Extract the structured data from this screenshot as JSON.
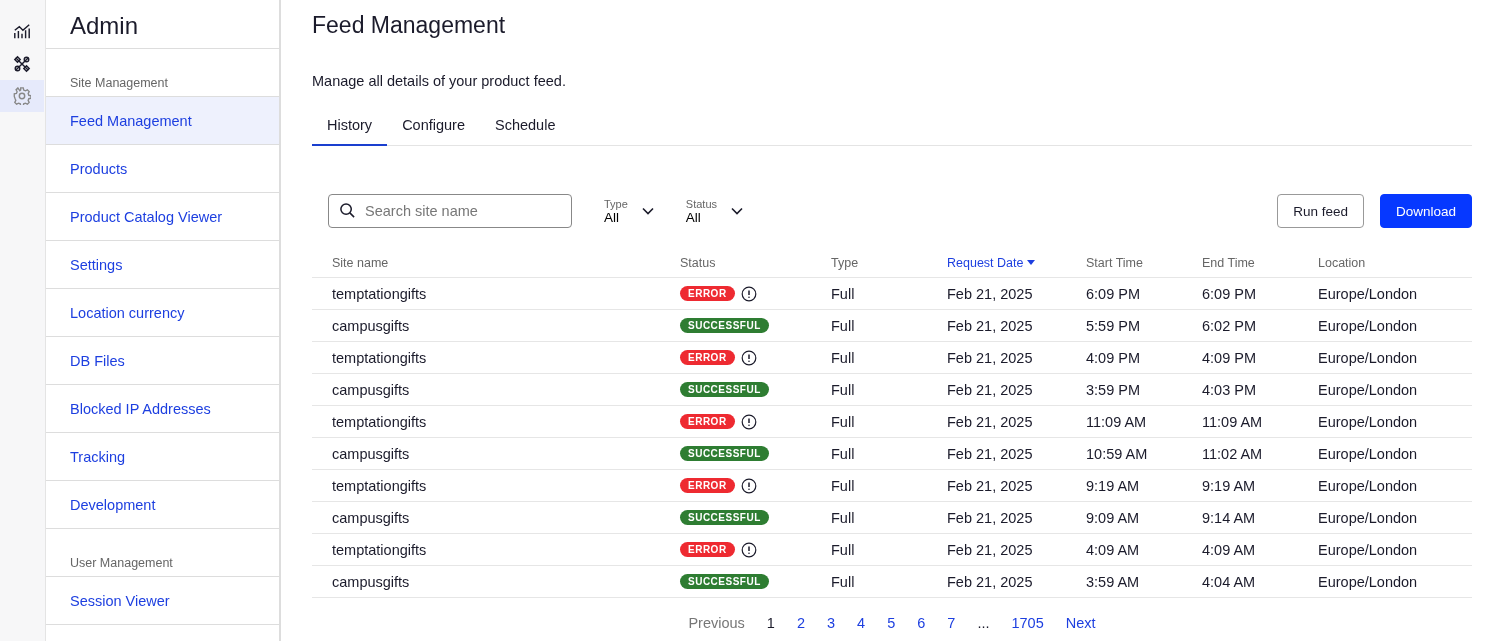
{
  "rail": [
    {
      "selected": false
    },
    {
      "selected": false
    },
    {
      "selected": true
    }
  ],
  "sidebar": {
    "title": "Admin",
    "sections": [
      {
        "label": "Site Management",
        "items": [
          {
            "label": "Feed Management",
            "selected": true
          },
          {
            "label": "Products",
            "selected": false
          },
          {
            "label": "Product Catalog Viewer",
            "selected": false
          },
          {
            "label": "Settings",
            "selected": false
          },
          {
            "label": "Location currency",
            "selected": false
          },
          {
            "label": "DB Files",
            "selected": false
          },
          {
            "label": "Blocked IP Addresses",
            "selected": false
          },
          {
            "label": "Tracking",
            "selected": false
          },
          {
            "label": "Development",
            "selected": false
          }
        ]
      },
      {
        "label": "User Management",
        "items": [
          {
            "label": "Session Viewer",
            "selected": false
          }
        ]
      }
    ]
  },
  "page": {
    "title": "Feed Management",
    "subtitle": "Manage all details of your product feed."
  },
  "tabs": [
    {
      "label": "History",
      "selected": true
    },
    {
      "label": "Configure",
      "selected": false
    },
    {
      "label": "Schedule",
      "selected": false
    }
  ],
  "search": {
    "placeholder": "Search site name"
  },
  "filters": [
    {
      "label": "Type",
      "value": "All"
    },
    {
      "label": "Status",
      "value": "All"
    }
  ],
  "buttons": [
    {
      "label": "Run feed",
      "kind": "secondary"
    },
    {
      "label": "Download",
      "kind": "primary"
    }
  ],
  "table": {
    "columns": [
      {
        "label": "Site name",
        "sorted": false
      },
      {
        "label": "Status",
        "sorted": false
      },
      {
        "label": "Type",
        "sorted": false
      },
      {
        "label": "Request Date",
        "sorted": true
      },
      {
        "label": "Start Time",
        "sorted": false
      },
      {
        "label": "End Time",
        "sorted": false
      },
      {
        "label": "Location",
        "sorted": false
      }
    ],
    "rows": [
      {
        "site": "temptationgifts",
        "status": "ERROR",
        "kind": "error",
        "type": "Full",
        "date": "Feb 21, 2025",
        "start": "6:09 PM",
        "end": "6:09 PM",
        "location": "Europe/London"
      },
      {
        "site": "campusgifts",
        "status": "SUCCESSFUL",
        "kind": "success",
        "type": "Full",
        "date": "Feb 21, 2025",
        "start": "5:59 PM",
        "end": "6:02 PM",
        "location": "Europe/London"
      },
      {
        "site": "temptationgifts",
        "status": "ERROR",
        "kind": "error",
        "type": "Full",
        "date": "Feb 21, 2025",
        "start": "4:09 PM",
        "end": "4:09 PM",
        "location": "Europe/London"
      },
      {
        "site": "campusgifts",
        "status": "SUCCESSFUL",
        "kind": "success",
        "type": "Full",
        "date": "Feb 21, 2025",
        "start": "3:59 PM",
        "end": "4:03 PM",
        "location": "Europe/London"
      },
      {
        "site": "temptationgifts",
        "status": "ERROR",
        "kind": "error",
        "type": "Full",
        "date": "Feb 21, 2025",
        "start": "11:09 AM",
        "end": "11:09 AM",
        "location": "Europe/London"
      },
      {
        "site": "campusgifts",
        "status": "SUCCESSFUL",
        "kind": "success",
        "type": "Full",
        "date": "Feb 21, 2025",
        "start": "10:59 AM",
        "end": "11:02 AM",
        "location": "Europe/London"
      },
      {
        "site": "temptationgifts",
        "status": "ERROR",
        "kind": "error",
        "type": "Full",
        "date": "Feb 21, 2025",
        "start": "9:19 AM",
        "end": "9:19 AM",
        "location": "Europe/London"
      },
      {
        "site": "campusgifts",
        "status": "SUCCESSFUL",
        "kind": "success",
        "type": "Full",
        "date": "Feb 21, 2025",
        "start": "9:09 AM",
        "end": "9:14 AM",
        "location": "Europe/London"
      },
      {
        "site": "temptationgifts",
        "status": "ERROR",
        "kind": "error",
        "type": "Full",
        "date": "Feb 21, 2025",
        "start": "4:09 AM",
        "end": "4:09 AM",
        "location": "Europe/London"
      },
      {
        "site": "campusgifts",
        "status": "SUCCESSFUL",
        "kind": "success",
        "type": "Full",
        "date": "Feb 21, 2025",
        "start": "3:59 AM",
        "end": "4:04 AM",
        "location": "Europe/London"
      }
    ]
  },
  "pagination": {
    "previous": {
      "label": "Previous",
      "disabled": true
    },
    "pages": [
      {
        "label": "1",
        "selected": true
      },
      {
        "label": "2",
        "selected": false
      },
      {
        "label": "3",
        "selected": false
      },
      {
        "label": "4",
        "selected": false
      },
      {
        "label": "5",
        "selected": false
      },
      {
        "label": "6",
        "selected": false
      },
      {
        "label": "7",
        "selected": false
      }
    ],
    "ellipsis": "...",
    "last": {
      "label": "1705",
      "selected": false
    },
    "next": {
      "label": "Next",
      "disabled": false
    }
  }
}
